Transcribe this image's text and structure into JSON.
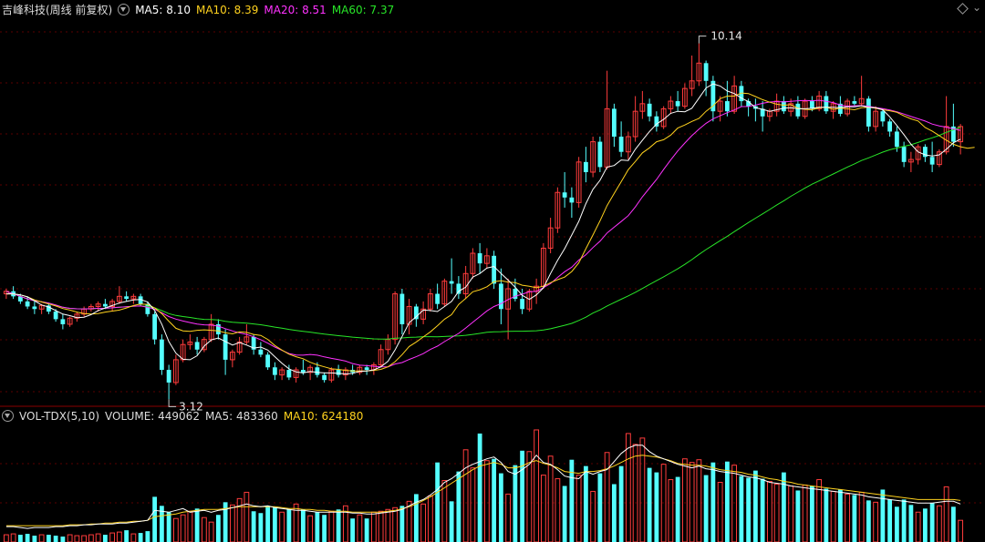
{
  "price_header": {
    "title": "吉峰科技(周线 前复权)",
    "ma5": "MA5: 8.10",
    "ma10": "MA10: 8.39",
    "ma20": "MA20: 8.51",
    "ma60": "MA60: 7.37"
  },
  "volume_header": {
    "indicator": "VOL-TDX(5,10)",
    "volume": "VOLUME: 449062",
    "ma5": "MA5: 483360",
    "ma10": "MA10: 624180"
  },
  "annotations": {
    "high_label": "10.14",
    "low_label": "3.12"
  },
  "colors": {
    "background": "#000000",
    "up": "#ff3c3c",
    "down": "#54ffff",
    "grid": "#5a0000",
    "ma5": "#ffffff",
    "ma10": "#ffd21e",
    "ma20": "#ff32ff",
    "ma60": "#28e628",
    "title": "#dcdcdc",
    "vol_ma5": "#ffffff",
    "vol_ma10": "#ffd21e"
  },
  "chart_data": {
    "type": "candlestick",
    "title": "吉峰科技(周线 前复权)",
    "candles": [
      [
        5.2,
        5.3,
        5.1,
        5.25
      ],
      [
        5.25,
        5.35,
        5.1,
        5.15
      ],
      [
        5.15,
        5.2,
        5.0,
        5.05
      ],
      [
        5.05,
        5.15,
        4.9,
        4.95
      ],
      [
        4.95,
        5.05,
        4.8,
        4.9
      ],
      [
        4.9,
        5.0,
        4.8,
        4.97
      ],
      [
        4.97,
        5.0,
        4.8,
        4.85
      ],
      [
        4.85,
        4.9,
        4.65,
        4.7
      ],
      [
        4.7,
        4.8,
        4.5,
        4.6
      ],
      [
        4.6,
        4.75,
        4.55,
        4.72
      ],
      [
        4.72,
        4.85,
        4.65,
        4.8
      ],
      [
        4.8,
        4.95,
        4.75,
        4.9
      ],
      [
        4.9,
        5.0,
        4.85,
        4.95
      ],
      [
        4.95,
        5.05,
        4.85,
        5.0
      ],
      [
        5.0,
        5.1,
        4.9,
        4.95
      ],
      [
        4.95,
        5.1,
        4.85,
        5.05
      ],
      [
        5.05,
        5.35,
        5.0,
        5.15
      ],
      [
        5.15,
        5.25,
        5.05,
        5.1
      ],
      [
        5.1,
        5.2,
        5.0,
        5.15
      ],
      [
        5.15,
        5.2,
        4.95,
        5.0
      ],
      [
        5.0,
        5.05,
        4.75,
        4.8
      ],
      [
        4.8,
        4.85,
        4.2,
        4.3
      ],
      [
        4.3,
        4.4,
        3.6,
        3.7
      ],
      [
        3.7,
        3.8,
        3.12,
        3.45
      ],
      [
        3.45,
        4.0,
        3.4,
        3.9
      ],
      [
        3.9,
        4.3,
        3.85,
        4.2
      ],
      [
        4.2,
        4.4,
        4.1,
        4.25
      ],
      [
        4.25,
        4.35,
        4.0,
        4.1
      ],
      [
        4.1,
        4.35,
        4.05,
        4.3
      ],
      [
        4.3,
        4.8,
        4.25,
        4.6
      ],
      [
        4.6,
        4.7,
        4.3,
        4.4
      ],
      [
        4.4,
        4.5,
        3.6,
        3.9
      ],
      [
        3.9,
        4.1,
        3.75,
        4.05
      ],
      [
        4.05,
        4.35,
        4.0,
        4.25
      ],
      [
        4.25,
        4.6,
        4.2,
        4.35
      ],
      [
        4.35,
        4.4,
        4.0,
        4.1
      ],
      [
        4.1,
        4.25,
        3.95,
        4.0
      ],
      [
        4.0,
        4.05,
        3.7,
        3.75
      ],
      [
        3.75,
        3.85,
        3.5,
        3.6
      ],
      [
        3.6,
        3.75,
        3.5,
        3.7
      ],
      [
        3.7,
        3.8,
        3.5,
        3.55
      ],
      [
        3.55,
        3.75,
        3.45,
        3.7
      ],
      [
        3.7,
        3.9,
        3.6,
        3.65
      ],
      [
        3.65,
        3.8,
        3.5,
        3.75
      ],
      [
        3.75,
        3.85,
        3.55,
        3.6
      ],
      [
        3.6,
        3.65,
        3.45,
        3.5
      ],
      [
        3.5,
        3.75,
        3.45,
        3.7
      ],
      [
        3.7,
        3.8,
        3.55,
        3.6
      ],
      [
        3.6,
        3.75,
        3.5,
        3.7
      ],
      [
        3.7,
        3.8,
        3.6,
        3.65
      ],
      [
        3.65,
        3.8,
        3.6,
        3.75
      ],
      [
        3.75,
        3.8,
        3.6,
        3.7
      ],
      [
        3.7,
        3.85,
        3.6,
        3.8
      ],
      [
        3.8,
        4.2,
        3.75,
        4.1
      ],
      [
        4.1,
        4.4,
        4.0,
        4.3
      ],
      [
        4.3,
        5.25,
        4.2,
        5.2
      ],
      [
        5.2,
        5.3,
        4.4,
        4.6
      ],
      [
        4.6,
        5.1,
        4.4,
        4.95
      ],
      [
        4.95,
        5.0,
        4.55,
        4.7
      ],
      [
        4.7,
        5.05,
        4.6,
        4.9
      ],
      [
        4.9,
        5.3,
        4.85,
        5.2
      ],
      [
        5.2,
        5.4,
        4.9,
        5.0
      ],
      [
        5.0,
        5.5,
        4.95,
        5.45
      ],
      [
        5.45,
        5.9,
        5.2,
        5.4
      ],
      [
        5.4,
        5.55,
        5.1,
        5.2
      ],
      [
        5.2,
        5.75,
        5.1,
        5.6
      ],
      [
        5.6,
        6.1,
        5.5,
        6.0
      ],
      [
        6.0,
        6.2,
        5.6,
        5.8
      ],
      [
        5.8,
        6.1,
        5.7,
        5.95
      ],
      [
        5.95,
        6.05,
        5.3,
        5.4
      ],
      [
        5.4,
        5.7,
        4.6,
        4.9
      ],
      [
        4.9,
        5.5,
        4.3,
        5.3
      ],
      [
        5.3,
        5.5,
        5.05,
        5.1
      ],
      [
        5.1,
        5.3,
        4.8,
        4.9
      ],
      [
        4.9,
        5.3,
        4.85,
        5.25
      ],
      [
        5.25,
        5.5,
        5.0,
        5.35
      ],
      [
        5.35,
        6.2,
        5.3,
        6.1
      ],
      [
        6.1,
        6.7,
        6.0,
        6.5
      ],
      [
        6.5,
        7.3,
        6.4,
        7.2
      ],
      [
        7.2,
        7.6,
        6.9,
        7.1
      ],
      [
        7.1,
        7.3,
        6.7,
        7.0
      ],
      [
        7.0,
        7.9,
        6.9,
        7.8
      ],
      [
        7.8,
        8.1,
        7.4,
        7.6
      ],
      [
        7.6,
        8.3,
        7.5,
        8.2
      ],
      [
        8.2,
        8.3,
        7.6,
        7.7
      ],
      [
        7.7,
        9.6,
        7.65,
        8.85
      ],
      [
        8.85,
        8.95,
        8.1,
        8.3
      ],
      [
        8.3,
        8.6,
        7.9,
        8.0
      ],
      [
        8.0,
        8.4,
        7.85,
        8.3
      ],
      [
        8.3,
        9.1,
        8.2,
        8.8
      ],
      [
        8.8,
        9.2,
        8.65,
        8.95
      ],
      [
        8.95,
        9.05,
        8.6,
        8.7
      ],
      [
        8.7,
        8.8,
        8.4,
        8.5
      ],
      [
        8.5,
        8.9,
        8.45,
        8.85
      ],
      [
        8.85,
        9.1,
        8.75,
        9.0
      ],
      [
        9.0,
        9.2,
        8.8,
        8.9
      ],
      [
        8.9,
        9.35,
        8.85,
        9.25
      ],
      [
        9.25,
        9.9,
        9.1,
        9.4
      ],
      [
        9.4,
        10.14,
        9.3,
        9.75
      ],
      [
        9.75,
        9.8,
        9.1,
        9.4
      ],
      [
        9.4,
        9.5,
        8.6,
        8.8
      ],
      [
        8.8,
        9.1,
        8.6,
        9.0
      ],
      [
        9.0,
        9.4,
        8.7,
        8.8
      ],
      [
        8.8,
        9.5,
        8.75,
        9.3
      ],
      [
        9.3,
        9.4,
        8.9,
        9.0
      ],
      [
        9.0,
        9.05,
        8.7,
        8.9
      ],
      [
        8.9,
        9.05,
        8.6,
        8.85
      ],
      [
        8.85,
        9.0,
        8.4,
        8.7
      ],
      [
        8.7,
        8.85,
        8.6,
        8.8
      ],
      [
        8.8,
        9.15,
        8.7,
        9.0
      ],
      [
        9.0,
        9.1,
        8.75,
        8.8
      ],
      [
        8.8,
        9.05,
        8.7,
        8.95
      ],
      [
        8.95,
        9.1,
        8.65,
        8.7
      ],
      [
        8.7,
        9.05,
        8.65,
        9.0
      ],
      [
        9.0,
        9.1,
        8.8,
        8.85
      ],
      [
        8.85,
        9.2,
        8.8,
        9.1
      ],
      [
        9.1,
        9.2,
        8.75,
        8.8
      ],
      [
        8.8,
        9.0,
        8.65,
        8.95
      ],
      [
        8.95,
        9.1,
        8.7,
        8.75
      ],
      [
        8.75,
        9.05,
        8.7,
        9.0
      ],
      [
        9.0,
        9.1,
        8.9,
        8.95
      ],
      [
        8.95,
        9.5,
        8.9,
        9.05
      ],
      [
        9.05,
        9.1,
        8.4,
        8.5
      ],
      [
        8.5,
        8.9,
        8.4,
        8.8
      ],
      [
        8.8,
        8.85,
        8.5,
        8.6
      ],
      [
        8.6,
        8.65,
        8.3,
        8.4
      ],
      [
        8.4,
        8.5,
        8.0,
        8.1
      ],
      [
        8.1,
        8.2,
        7.7,
        7.8
      ],
      [
        7.8,
        8.0,
        7.6,
        7.85
      ],
      [
        7.85,
        8.15,
        7.75,
        8.1
      ],
      [
        8.1,
        8.15,
        7.8,
        7.9
      ],
      [
        7.9,
        8.2,
        7.6,
        7.75
      ],
      [
        7.75,
        8.05,
        7.7,
        8.0
      ],
      [
        8.0,
        9.1,
        7.95,
        8.5
      ],
      [
        8.5,
        8.95,
        8.1,
        8.2
      ],
      [
        8.2,
        8.55,
        7.95,
        8.5
      ]
    ],
    "ma5": [
      5.2,
      5.2,
      5.18,
      5.14,
      5.06,
      4.98,
      4.94,
      4.87,
      4.8,
      4.77,
      4.73,
      4.74,
      4.79,
      4.87,
      4.92,
      4.97,
      5.02,
      5.05,
      5.08,
      5.09,
      5.04,
      4.87,
      4.6,
      4.26,
      4.03,
      3.91,
      3.9,
      3.98,
      4.17,
      4.29,
      4.33,
      4.26,
      4.19,
      4.24,
      4.19,
      4.13,
      4.15,
      4.09,
      3.96,
      3.83,
      3.72,
      3.66,
      3.64,
      3.67,
      3.65,
      3.64,
      3.64,
      3.63,
      3.62,
      3.63,
      3.67,
      3.68,
      3.7,
      3.76,
      3.87,
      4.09,
      4.36,
      4.63,
      4.75,
      4.88,
      4.87,
      4.85,
      4.95,
      5.05,
      5.25,
      5.33,
      5.53,
      5.6,
      5.71,
      5.74,
      5.6,
      5.47,
      5.33,
      5.17,
      5.09,
      5.18,
      5.32,
      5.6,
      5.86,
      6.09,
      6.36,
      6.63,
      6.98,
      7.26,
      7.44,
      7.7,
      7.73,
      7.84,
      7.83,
      8.05,
      8.23,
      8.4,
      8.55,
      8.64,
      8.76,
      8.8,
      8.79,
      8.86,
      9.06,
      9.26,
      9.34,
      9.3,
      9.2,
      9.15,
      9.06,
      8.99,
      8.87,
      8.84,
      8.8,
      8.83,
      8.86,
      8.87,
      8.85,
      8.85,
      8.86,
      8.88,
      8.88,
      8.88,
      8.87,
      8.89,
      8.89,
      8.91,
      8.88,
      8.87,
      8.83,
      8.69,
      8.52,
      8.34,
      8.15,
      8.0,
      7.94,
      7.92,
      7.94,
      8.05,
      8.18,
      8.25
    ],
    "ma10": [
      5.2,
      5.2,
      5.18,
      5.14,
      5.08,
      5.04,
      5.0,
      4.96,
      4.91,
      4.88,
      4.84,
      4.81,
      4.8,
      4.81,
      4.84,
      4.86,
      4.88,
      4.92,
      4.97,
      5.0,
      4.99,
      4.92,
      4.81,
      4.66,
      4.52,
      4.47,
      4.46,
      4.48,
      4.49,
      4.48,
      4.47,
      4.43,
      4.41,
      4.45,
      4.44,
      4.4,
      4.38,
      4.3,
      4.18,
      4.09,
      4.01,
      3.96,
      3.92,
      3.85,
      3.8,
      3.76,
      3.72,
      3.71,
      3.69,
      3.68,
      3.68,
      3.68,
      3.69,
      3.71,
      3.76,
      3.86,
      4.0,
      4.16,
      4.25,
      4.35,
      4.45,
      4.57,
      4.7,
      4.79,
      4.99,
      5.11,
      5.24,
      5.28,
      5.34,
      5.44,
      5.46,
      5.43,
      5.42,
      5.37,
      5.35,
      5.32,
      5.35,
      5.42,
      5.48,
      5.53,
      5.64,
      5.81,
      6.09,
      6.36,
      6.64,
      6.94,
      7.18,
      7.41,
      7.65,
      7.81,
      7.98,
      8.08,
      8.2,
      8.24,
      8.33,
      8.47,
      8.53,
      8.6,
      8.66,
      8.8,
      8.91,
      9.05,
      9.1,
      9.1,
      9.16,
      9.15,
      9.09,
      9.03,
      8.98,
      8.94,
      8.92,
      8.93,
      8.86,
      8.84,
      8.83,
      8.87,
      8.88,
      8.84,
      8.86,
      8.85,
      8.83,
      8.87,
      8.88,
      8.86,
      8.83,
      8.81,
      8.78,
      8.71,
      8.65,
      8.61,
      8.48,
      8.41,
      8.32,
      8.23,
      8.15,
      8.1,
      8.07,
      8.09
    ]
  },
  "volume_data": {
    "type": "bar",
    "series_name": "VOLUME",
    "up": [
      1,
      1,
      0,
      0,
      0,
      1,
      0,
      0,
      0,
      1,
      1,
      1,
      1,
      1,
      0,
      1,
      1,
      0,
      1,
      0,
      0,
      0,
      0,
      0,
      1,
      1,
      1,
      0,
      1,
      1,
      0,
      0,
      1,
      1,
      1,
      0,
      0,
      0,
      0,
      1,
      0,
      1,
      0,
      1,
      0,
      0,
      1,
      0,
      1,
      0,
      1,
      0,
      1,
      1,
      1,
      1,
      0,
      1,
      0,
      1,
      1,
      0,
      1,
      0,
      0,
      1,
      1,
      0,
      1,
      0,
      0,
      1,
      0,
      0,
      1,
      1,
      1,
      1,
      1,
      0,
      0,
      1,
      0,
      1,
      0,
      1,
      0,
      0,
      1,
      1,
      1,
      0,
      0,
      1,
      1,
      0,
      1,
      1,
      1,
      0,
      0,
      1,
      0,
      1,
      0,
      0,
      0,
      0,
      1,
      1,
      0,
      1,
      0,
      1,
      0,
      1,
      0,
      1,
      0,
      1,
      0,
      1,
      0,
      1,
      0,
      0,
      0,
      0,
      0,
      1,
      0,
      0,
      1,
      1,
      0,
      1
    ],
    "values": [
      8,
      9,
      8,
      9,
      7,
      8,
      8,
      7,
      6,
      8,
      7,
      7,
      8,
      9,
      8,
      10,
      11,
      13,
      9,
      10,
      12,
      50,
      40,
      33,
      26,
      30,
      34,
      37,
      27,
      22,
      30,
      44,
      41,
      48,
      55,
      34,
      32,
      40,
      38,
      33,
      36,
      42,
      36,
      29,
      33,
      30,
      34,
      36,
      40,
      26,
      30,
      26,
      33,
      34,
      36,
      38,
      40,
      45,
      53,
      42,
      51,
      88,
      68,
      45,
      78,
      102,
      82,
      120,
      90,
      92,
      76,
      53,
      85,
      101,
      100,
      124,
      74,
      95,
      70,
      62,
      91,
      74,
      84,
      56,
      76,
      99,
      64,
      84,
      120,
      108,
      115,
      82,
      77,
      86,
      69,
      72,
      92,
      88,
      91,
      74,
      88,
      66,
      89,
      85,
      73,
      71,
      79,
      70,
      67,
      64,
      77,
      62,
      57,
      63,
      62,
      69,
      59,
      56,
      58,
      53,
      52,
      55,
      46,
      44,
      58,
      47,
      39,
      47,
      41,
      33,
      37,
      43,
      40,
      61,
      39,
      24
    ],
    "vol_ma5": [
      17,
      17,
      16,
      15,
      16,
      16,
      16,
      17,
      17,
      18,
      18,
      19,
      19,
      20,
      20,
      20,
      21,
      21,
      22,
      23,
      24,
      35,
      34,
      33,
      35,
      37,
      33,
      34,
      35,
      33,
      35,
      36,
      38,
      40,
      42,
      40,
      39,
      40,
      38,
      37,
      36,
      35,
      35,
      34,
      33,
      33,
      33,
      33,
      33,
      32,
      32,
      31,
      31,
      32,
      33,
      34,
      36,
      40,
      44,
      47,
      52,
      58,
      66,
      70,
      76,
      82,
      86,
      89,
      92,
      94,
      88,
      78,
      75,
      80,
      86,
      96,
      88,
      86,
      80,
      73,
      71,
      70,
      78,
      75,
      78,
      80,
      89,
      98,
      104,
      107,
      107,
      100,
      95,
      92,
      89,
      86,
      84,
      82,
      84,
      81,
      80,
      78,
      77,
      76,
      74,
      72,
      71,
      69,
      66,
      65,
      64,
      62,
      61,
      60,
      59,
      58,
      57,
      56,
      55,
      54,
      53,
      52,
      50,
      49,
      48,
      47,
      46,
      45,
      44,
      43,
      43,
      43,
      44,
      45,
      45,
      42
    ],
    "vol_ma10": [
      18,
      18,
      18,
      18,
      18,
      18,
      18,
      18,
      18,
      19,
      19,
      19,
      20,
      20,
      21,
      21,
      22,
      22,
      23,
      23,
      24,
      28,
      29,
      30,
      31,
      33,
      34,
      35,
      36,
      36,
      36,
      37,
      38,
      39,
      39,
      39,
      39,
      39,
      39,
      38,
      37,
      37,
      36,
      36,
      35,
      35,
      34,
      34,
      34,
      33,
      33,
      33,
      33,
      33,
      34,
      35,
      37,
      39,
      42,
      46,
      50,
      55,
      60,
      65,
      70,
      75,
      80,
      84,
      86,
      88,
      86,
      82,
      82,
      84,
      88,
      90,
      87,
      85,
      82,
      78,
      77,
      76,
      78,
      78,
      79,
      81,
      84,
      88,
      92,
      95,
      96,
      95,
      94,
      92,
      90,
      87,
      86,
      85,
      85,
      84,
      82,
      80,
      79,
      78,
      77,
      75,
      74,
      72,
      70,
      69,
      67,
      66,
      64,
      63,
      62,
      61,
      60,
      59,
      58,
      57,
      56,
      55,
      54,
      53,
      52,
      51,
      50,
      49,
      48,
      47,
      47,
      47,
      47,
      47,
      47,
      46
    ]
  }
}
